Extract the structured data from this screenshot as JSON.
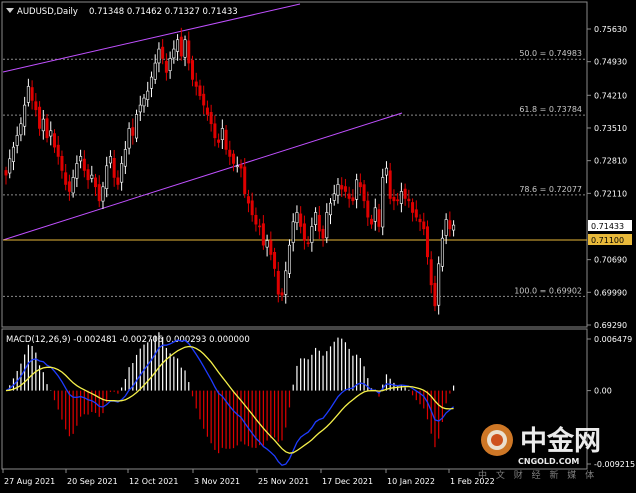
{
  "header": {
    "symbol": "AUDUSD,Daily",
    "ohlc": "0.71348 0.71462 0.71327 0.71433"
  },
  "macd_header": {
    "text": "MACD(12,26,9) -0.002481 -0.002706 0.000293 0.000000"
  },
  "watermark": {
    "cn": "中金网",
    "url": "CNGOLD.COM",
    "sub": "中 文 财 经 新 媒 体"
  },
  "chart_data": [
    {
      "type": "candlestick",
      "symbol": "AUDUSD",
      "timeframe": "Daily",
      "ylim": [
        0.6929,
        0.7572
      ],
      "y_ticks": [
        "0.75630",
        "0.74930",
        "0.74210",
        "0.73510",
        "0.72810",
        "0.72110",
        "0.71433",
        "0.71100",
        "0.70690",
        "0.69990",
        "0.69290"
      ],
      "x_ticks": [
        "27 Aug 2021",
        "20 Sep 2021",
        "12 Oct 2021",
        "3 Nov 2021",
        "25 Nov 2021",
        "17 Dec 2021",
        "10 Jan 2022",
        "1 Feb 2022"
      ],
      "current_price": "0.71433",
      "horizontal_line": "0.71100",
      "fibonacci": [
        {
          "label": "50.0 = 0.74983",
          "value": 0.74983
        },
        {
          "label": "61.8 = 0.73784",
          "value": 0.73784
        },
        {
          "label": "78.6 = 0.72077",
          "value": 0.72077
        },
        {
          "label": "100.0 = 0.69902",
          "value": 0.69902
        }
      ],
      "closes": [
        0.725,
        0.7285,
        0.731,
        0.7335,
        0.736,
        0.74,
        0.744,
        0.741,
        0.739,
        0.735,
        0.737,
        0.733,
        0.7345,
        0.731,
        0.729,
        0.726,
        0.723,
        0.7215,
        0.7245,
        0.7275,
        0.729,
        0.726,
        0.724,
        0.725,
        0.7225,
        0.7195,
        0.7225,
        0.727,
        0.729,
        0.7245,
        0.723,
        0.7275,
        0.7305,
        0.735,
        0.7335,
        0.738,
        0.74,
        0.7415,
        0.743,
        0.746,
        0.749,
        0.752,
        0.75,
        0.747,
        0.75,
        0.752,
        0.754,
        0.7505,
        0.754,
        0.749,
        0.7455,
        0.744,
        0.742,
        0.74,
        0.738,
        0.736,
        0.733,
        0.732,
        0.735,
        0.7305,
        0.729,
        0.7275,
        0.727,
        0.7265,
        0.721,
        0.719,
        0.7165,
        0.7145,
        0.714,
        0.71,
        0.711,
        0.708,
        0.705,
        0.6995,
        0.6993,
        0.7045,
        0.71,
        0.715,
        0.717,
        0.714,
        0.711,
        0.7105,
        0.714,
        0.717,
        0.713,
        0.7115,
        0.717,
        0.719,
        0.721,
        0.723,
        0.722,
        0.7215,
        0.72,
        0.7195,
        0.724,
        0.7225,
        0.7195,
        0.716,
        0.7145,
        0.718,
        0.714,
        0.7245,
        0.7265,
        0.72,
        0.7195,
        0.7195,
        0.7215,
        0.72,
        0.7195,
        0.717,
        0.716,
        0.715,
        0.7135,
        0.7075,
        0.7015,
        0.697,
        0.706,
        0.7115,
        0.7155,
        0.7135,
        0.7143
      ]
    },
    {
      "type": "macd",
      "name": "MACD(12,26,9)",
      "values": {
        "main": -0.002481,
        "signal": -0.002706,
        "histogram": 0.000293,
        "extra": 0.0
      },
      "y_ticks": [
        "0.006479",
        "0.00",
        "-0.009215"
      ]
    }
  ],
  "colors": {
    "bull": "#ffffff",
    "bear": "#e00000",
    "channel": "#c050ff",
    "hline": "#e8b93a",
    "macd_line": "#1e3cff",
    "signal_line": "#f5f04a",
    "grid_dotted": "#808080"
  }
}
